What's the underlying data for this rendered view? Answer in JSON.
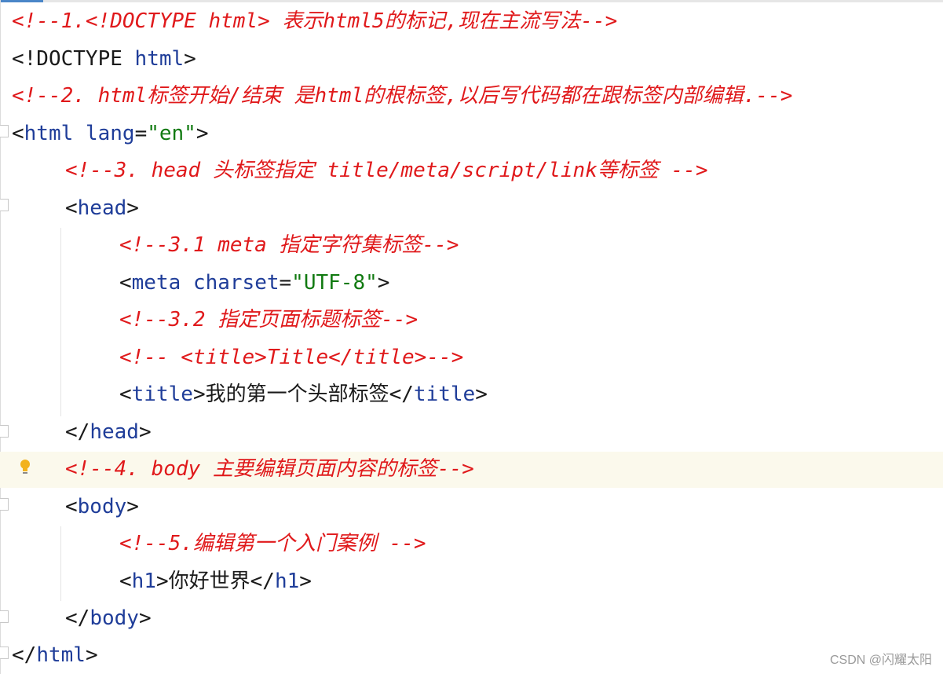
{
  "editor": {
    "lines": [
      {
        "comment": "<!--1.<!DOCTYPE html> 表示html5的标记,现在主流写法-->"
      },
      {
        "doctype": "<!DOCTYPE",
        "doctype_name": "html",
        "doctype_end": ">"
      },
      {
        "comment": "<!--2. html标签开始/结束 是html的根标签,以后写代码都在跟标签内部编辑.-->"
      },
      {
        "open": "<",
        "tag": "html",
        "attr": "lang",
        "eq": "=",
        "value": "\"en\"",
        "close": ">"
      },
      {
        "comment": "<!--3. head 头标签指定 title/meta/script/link等标签 -->"
      },
      {
        "open": "<",
        "tag": "head",
        "close": ">"
      },
      {
        "comment": "<!--3.1 meta 指定字符集标签-->"
      },
      {
        "open": "<",
        "tag": "meta",
        "attr": "charset",
        "eq": "=",
        "value": "\"UTF-8\"",
        "close": ">"
      },
      {
        "comment": "<!--3.2 指定页面标题标签-->"
      },
      {
        "comment": "<!-- <title>Title</title>-->"
      },
      {
        "open": "<",
        "tag": "title",
        "close": ">",
        "text": "我的第一个头部标签",
        "end_open": "</",
        "end_tag": "title",
        "end_close": ">"
      },
      {
        "open": "</",
        "tag": "head",
        "close": ">"
      },
      {
        "comment": "<!--4. body 主要编辑页面内容的标签-->"
      },
      {
        "open": "<",
        "tag": "body",
        "close": ">"
      },
      {
        "comment": "<!--5.编辑第一个入门案例 -->"
      },
      {
        "open": "<",
        "tag": "h1",
        "close": ">",
        "text": "你好世界",
        "end_open": "</",
        "end_tag": "h1",
        "end_close": ">"
      },
      {
        "open": "</",
        "tag": "body",
        "close": ">"
      },
      {
        "open": "</",
        "tag": "html",
        "close": ">"
      }
    ]
  },
  "icons": {
    "intention_bulb": "lightbulb-icon",
    "fold_marker": "fold-marker-icon"
  },
  "colors": {
    "comment": "#e0191b",
    "tag": "#1f3d99",
    "attr_value": "#117a11",
    "current_line": "#fbf9ec",
    "bulb": "#f2b21e"
  },
  "watermark": "CSDN @闪耀太阳"
}
